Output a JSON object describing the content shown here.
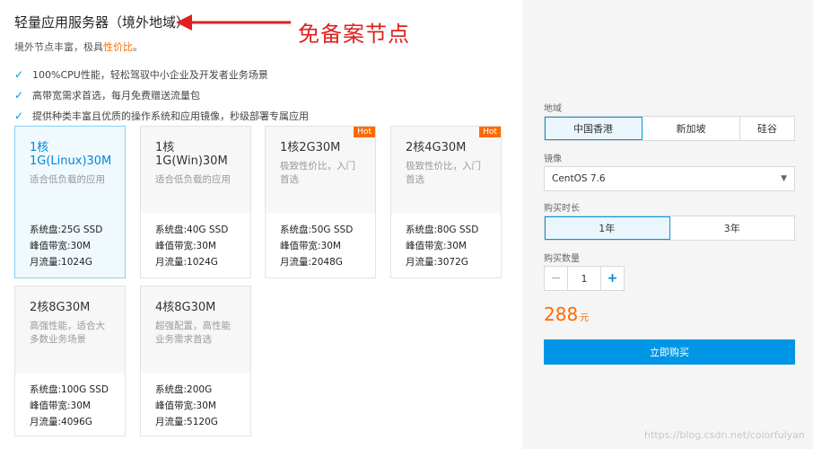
{
  "header": {
    "title": "轻量应用服务器（境外地域）",
    "subtitle_prefix": "境外节点丰富，极具",
    "subtitle_highlight": "性价比",
    "subtitle_suffix": "。",
    "annotation": "免备案节点"
  },
  "features": [
    "100%CPU性能，轻松驾驭中小企业及开发者业务场景",
    "高带宽需求首选，每月免费赠送流量包",
    "提供种类丰富且优质的操作系统和应用镜像，秒级部署专属应用"
  ],
  "plans": [
    {
      "name": "1核1G(Linux)30M",
      "desc": "适合低负载的应用",
      "disk": "系统盘:25G SSD",
      "bandwidth": "峰值带宽:30M",
      "traffic": "月流量:1024G"
    },
    {
      "name": "1核1G(Win)30M",
      "desc": "适合低负载的应用",
      "disk": "系统盘:40G SSD",
      "bandwidth": "峰值带宽:30M",
      "traffic": "月流量:1024G"
    },
    {
      "name": "1核2G30M",
      "desc": "极致性价比，入门首选",
      "disk": "系统盘:50G SSD",
      "bandwidth": "峰值带宽:30M",
      "traffic": "月流量:2048G",
      "badge": "Hot"
    },
    {
      "name": "2核4G30M",
      "desc": "极致性价比，入门首选",
      "disk": "系统盘:80G SSD",
      "bandwidth": "峰值带宽:30M",
      "traffic": "月流量:3072G",
      "badge": "Hot"
    },
    {
      "name": "2核8G30M",
      "desc": "高强性能，适合大多数业务场景",
      "disk": "系统盘:100G SSD",
      "bandwidth": "峰值带宽:30M",
      "traffic": "月流量:4096G"
    },
    {
      "name": "4核8G30M",
      "desc": "超强配置，高性能业务需求首选",
      "disk": "系统盘:200G",
      "bandwidth": "峰值带宽:30M",
      "traffic": "月流量:5120G"
    }
  ],
  "panel": {
    "region_label": "地域",
    "regions": [
      "中国香港",
      "新加坡",
      "硅谷"
    ],
    "image_label": "镜像",
    "image_value": "CentOS 7.6",
    "duration_label": "购买时长",
    "durations": [
      "1年",
      "3年"
    ],
    "quantity_label": "购买数量",
    "quantity_minus": "−",
    "quantity_value": "1",
    "quantity_plus": "+",
    "price": "288",
    "price_unit": "元",
    "buy_label": "立即购买"
  },
  "watermark": "https://blog.csdn.net/colorfulyan",
  "colors": {
    "accent": "#0096e6",
    "price": "#ff6a00",
    "hot": "#ff6a00",
    "annotation": "#e02020"
  }
}
